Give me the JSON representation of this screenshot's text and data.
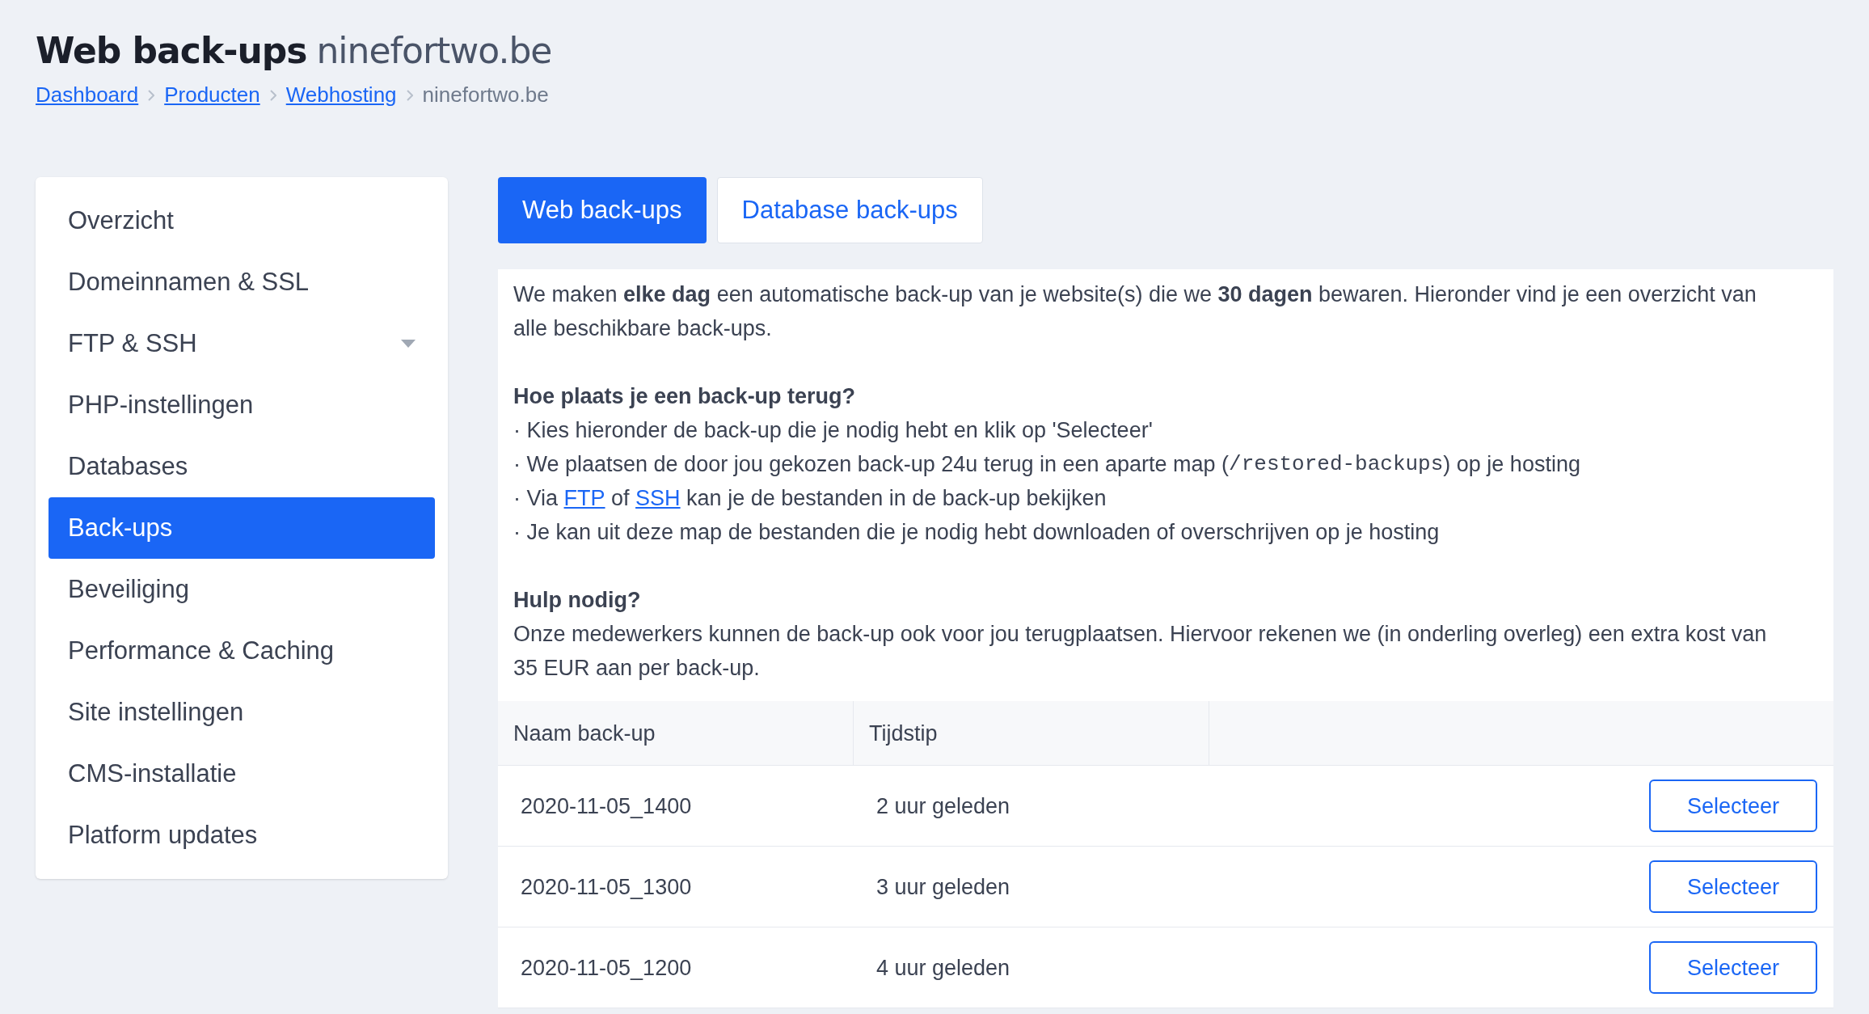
{
  "header": {
    "title": "Web back-ups",
    "subtitle": "ninefortwo.be",
    "breadcrumbs": [
      {
        "label": "Dashboard",
        "kind": "link"
      },
      {
        "label": "Producten",
        "kind": "link"
      },
      {
        "label": "Webhosting",
        "kind": "link"
      },
      {
        "label": "ninefortwo.be",
        "kind": "current"
      }
    ]
  },
  "sidebar": {
    "items": [
      {
        "label": "Overzicht",
        "kind": "link",
        "selected": false
      },
      {
        "label": "Domeinnamen & SSL",
        "kind": "link",
        "selected": false
      },
      {
        "label": "FTP & SSH",
        "kind": "dropdown",
        "selected": false
      },
      {
        "label": "PHP-instellingen",
        "kind": "link",
        "selected": false
      },
      {
        "label": "Databases",
        "kind": "link",
        "selected": false
      },
      {
        "label": "Back-ups",
        "kind": "link",
        "selected": true
      },
      {
        "label": "Beveiliging",
        "kind": "link",
        "selected": false
      },
      {
        "label": "Performance & Caching",
        "kind": "link",
        "selected": false
      },
      {
        "label": "Site instellingen",
        "kind": "link",
        "selected": false
      },
      {
        "label": "CMS-installatie",
        "kind": "link",
        "selected": false
      },
      {
        "label": "Platform updates",
        "kind": "link",
        "selected": false
      }
    ]
  },
  "tabs": [
    {
      "label": "Web back-ups",
      "selected": true
    },
    {
      "label": "Database back-ups",
      "selected": false
    }
  ],
  "info": {
    "intro": "We maken **elke dag** een automatische back-up van je website(s) die we **30 dagen** bewaren. Hieronder vind je een overzicht van alle beschikbare back-ups.",
    "restore_heading": "Hoe plaats je een back-up terug?",
    "restore_steps": [
      [
        {
          "kind": "text",
          "text": "· Kies hieronder de back-up die je nodig hebt en klik op 'Selecteer'"
        }
      ],
      [
        {
          "kind": "text",
          "text": "· We plaatsen de door jou gekozen back-up 24u terug in een aparte map ("
        },
        {
          "kind": "code",
          "text": "/restored-backups"
        },
        {
          "kind": "text",
          "text": ") op je hosting"
        }
      ],
      [
        {
          "kind": "text",
          "text": "· Via "
        },
        {
          "kind": "link",
          "text": "FTP"
        },
        {
          "kind": "text",
          "text": " of "
        },
        {
          "kind": "link",
          "text": "SSH"
        },
        {
          "kind": "text",
          "text": " kan je de bestanden in de back-up bekijken"
        }
      ],
      [
        {
          "kind": "text",
          "text": "· Je kan uit deze map de bestanden die je nodig hebt downloaden of overschrijven op je hosting"
        }
      ]
    ],
    "help_heading": "Hulp nodig?",
    "help_text": "Onze medewerkers kunnen de back-up ook voor jou terugplaatsen. Hiervoor rekenen we (in onderling overleg) een extra kost van 35 EUR aan per back-up."
  },
  "table": {
    "columns": [
      "Naam back-up",
      "Tijdstip"
    ],
    "rows": [
      {
        "name": "2020-11-05_1400",
        "time": "2 uur geleden",
        "action": "Selecteer"
      },
      {
        "name": "2020-11-05_1300",
        "time": "3 uur geleden",
        "action": "Selecteer"
      },
      {
        "name": "2020-11-05_1200",
        "time": "4 uur geleden",
        "action": "Selecteer"
      }
    ]
  }
}
